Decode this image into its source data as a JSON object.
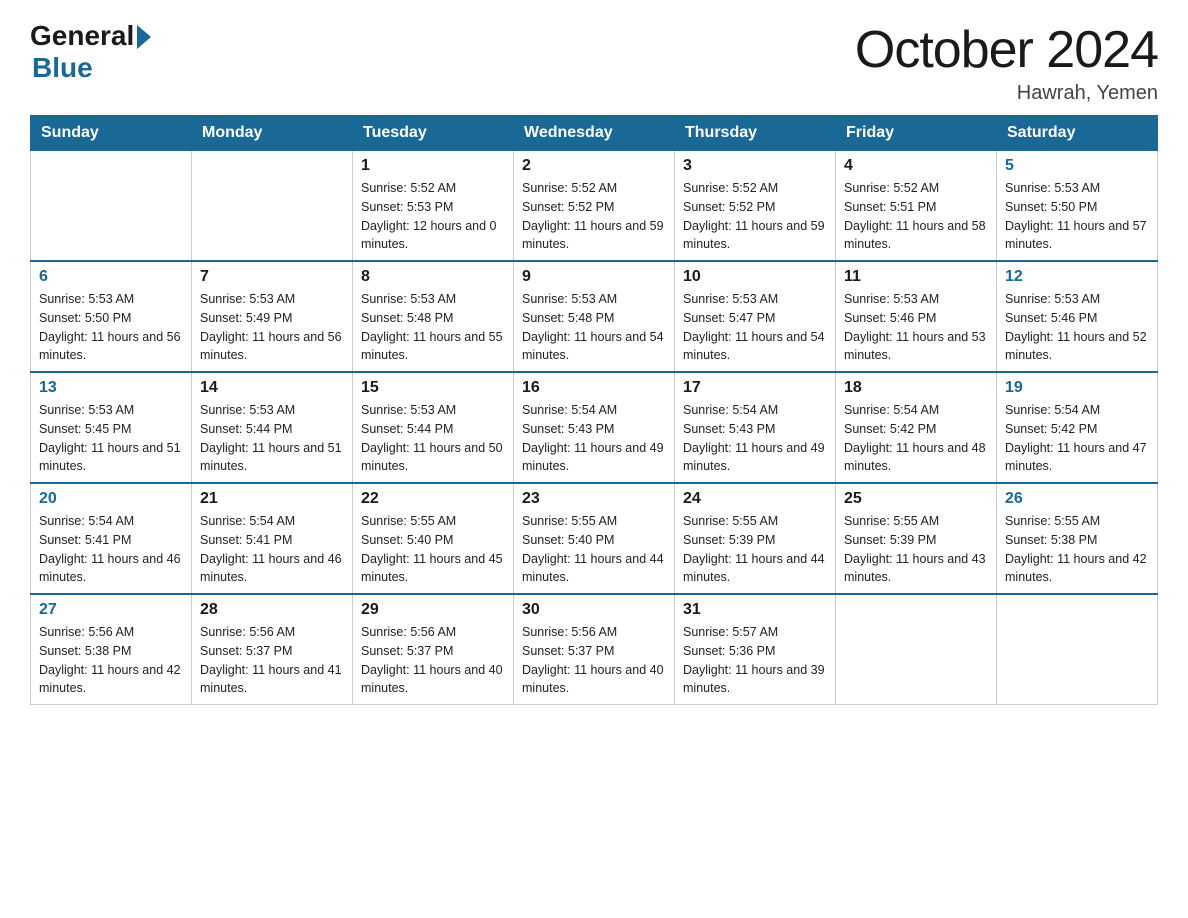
{
  "logo": {
    "general": "General",
    "blue": "Blue"
  },
  "title": "October 2024",
  "location": "Hawrah, Yemen",
  "headers": [
    "Sunday",
    "Monday",
    "Tuesday",
    "Wednesday",
    "Thursday",
    "Friday",
    "Saturday"
  ],
  "weeks": [
    [
      {
        "day": "",
        "sunrise": "",
        "sunset": "",
        "daylight": ""
      },
      {
        "day": "",
        "sunrise": "",
        "sunset": "",
        "daylight": ""
      },
      {
        "day": "1",
        "sunrise": "Sunrise: 5:52 AM",
        "sunset": "Sunset: 5:53 PM",
        "daylight": "Daylight: 12 hours and 0 minutes."
      },
      {
        "day": "2",
        "sunrise": "Sunrise: 5:52 AM",
        "sunset": "Sunset: 5:52 PM",
        "daylight": "Daylight: 11 hours and 59 minutes."
      },
      {
        "day": "3",
        "sunrise": "Sunrise: 5:52 AM",
        "sunset": "Sunset: 5:52 PM",
        "daylight": "Daylight: 11 hours and 59 minutes."
      },
      {
        "day": "4",
        "sunrise": "Sunrise: 5:52 AM",
        "sunset": "Sunset: 5:51 PM",
        "daylight": "Daylight: 11 hours and 58 minutes."
      },
      {
        "day": "5",
        "sunrise": "Sunrise: 5:53 AM",
        "sunset": "Sunset: 5:50 PM",
        "daylight": "Daylight: 11 hours and 57 minutes."
      }
    ],
    [
      {
        "day": "6",
        "sunrise": "Sunrise: 5:53 AM",
        "sunset": "Sunset: 5:50 PM",
        "daylight": "Daylight: 11 hours and 56 minutes."
      },
      {
        "day": "7",
        "sunrise": "Sunrise: 5:53 AM",
        "sunset": "Sunset: 5:49 PM",
        "daylight": "Daylight: 11 hours and 56 minutes."
      },
      {
        "day": "8",
        "sunrise": "Sunrise: 5:53 AM",
        "sunset": "Sunset: 5:48 PM",
        "daylight": "Daylight: 11 hours and 55 minutes."
      },
      {
        "day": "9",
        "sunrise": "Sunrise: 5:53 AM",
        "sunset": "Sunset: 5:48 PM",
        "daylight": "Daylight: 11 hours and 54 minutes."
      },
      {
        "day": "10",
        "sunrise": "Sunrise: 5:53 AM",
        "sunset": "Sunset: 5:47 PM",
        "daylight": "Daylight: 11 hours and 54 minutes."
      },
      {
        "day": "11",
        "sunrise": "Sunrise: 5:53 AM",
        "sunset": "Sunset: 5:46 PM",
        "daylight": "Daylight: 11 hours and 53 minutes."
      },
      {
        "day": "12",
        "sunrise": "Sunrise: 5:53 AM",
        "sunset": "Sunset: 5:46 PM",
        "daylight": "Daylight: 11 hours and 52 minutes."
      }
    ],
    [
      {
        "day": "13",
        "sunrise": "Sunrise: 5:53 AM",
        "sunset": "Sunset: 5:45 PM",
        "daylight": "Daylight: 11 hours and 51 minutes."
      },
      {
        "day": "14",
        "sunrise": "Sunrise: 5:53 AM",
        "sunset": "Sunset: 5:44 PM",
        "daylight": "Daylight: 11 hours and 51 minutes."
      },
      {
        "day": "15",
        "sunrise": "Sunrise: 5:53 AM",
        "sunset": "Sunset: 5:44 PM",
        "daylight": "Daylight: 11 hours and 50 minutes."
      },
      {
        "day": "16",
        "sunrise": "Sunrise: 5:54 AM",
        "sunset": "Sunset: 5:43 PM",
        "daylight": "Daylight: 11 hours and 49 minutes."
      },
      {
        "day": "17",
        "sunrise": "Sunrise: 5:54 AM",
        "sunset": "Sunset: 5:43 PM",
        "daylight": "Daylight: 11 hours and 49 minutes."
      },
      {
        "day": "18",
        "sunrise": "Sunrise: 5:54 AM",
        "sunset": "Sunset: 5:42 PM",
        "daylight": "Daylight: 11 hours and 48 minutes."
      },
      {
        "day": "19",
        "sunrise": "Sunrise: 5:54 AM",
        "sunset": "Sunset: 5:42 PM",
        "daylight": "Daylight: 11 hours and 47 minutes."
      }
    ],
    [
      {
        "day": "20",
        "sunrise": "Sunrise: 5:54 AM",
        "sunset": "Sunset: 5:41 PM",
        "daylight": "Daylight: 11 hours and 46 minutes."
      },
      {
        "day": "21",
        "sunrise": "Sunrise: 5:54 AM",
        "sunset": "Sunset: 5:41 PM",
        "daylight": "Daylight: 11 hours and 46 minutes."
      },
      {
        "day": "22",
        "sunrise": "Sunrise: 5:55 AM",
        "sunset": "Sunset: 5:40 PM",
        "daylight": "Daylight: 11 hours and 45 minutes."
      },
      {
        "day": "23",
        "sunrise": "Sunrise: 5:55 AM",
        "sunset": "Sunset: 5:40 PM",
        "daylight": "Daylight: 11 hours and 44 minutes."
      },
      {
        "day": "24",
        "sunrise": "Sunrise: 5:55 AM",
        "sunset": "Sunset: 5:39 PM",
        "daylight": "Daylight: 11 hours and 44 minutes."
      },
      {
        "day": "25",
        "sunrise": "Sunrise: 5:55 AM",
        "sunset": "Sunset: 5:39 PM",
        "daylight": "Daylight: 11 hours and 43 minutes."
      },
      {
        "day": "26",
        "sunrise": "Sunrise: 5:55 AM",
        "sunset": "Sunset: 5:38 PM",
        "daylight": "Daylight: 11 hours and 42 minutes."
      }
    ],
    [
      {
        "day": "27",
        "sunrise": "Sunrise: 5:56 AM",
        "sunset": "Sunset: 5:38 PM",
        "daylight": "Daylight: 11 hours and 42 minutes."
      },
      {
        "day": "28",
        "sunrise": "Sunrise: 5:56 AM",
        "sunset": "Sunset: 5:37 PM",
        "daylight": "Daylight: 11 hours and 41 minutes."
      },
      {
        "day": "29",
        "sunrise": "Sunrise: 5:56 AM",
        "sunset": "Sunset: 5:37 PM",
        "daylight": "Daylight: 11 hours and 40 minutes."
      },
      {
        "day": "30",
        "sunrise": "Sunrise: 5:56 AM",
        "sunset": "Sunset: 5:37 PM",
        "daylight": "Daylight: 11 hours and 40 minutes."
      },
      {
        "day": "31",
        "sunrise": "Sunrise: 5:57 AM",
        "sunset": "Sunset: 5:36 PM",
        "daylight": "Daylight: 11 hours and 39 minutes."
      },
      {
        "day": "",
        "sunrise": "",
        "sunset": "",
        "daylight": ""
      },
      {
        "day": "",
        "sunrise": "",
        "sunset": "",
        "daylight": ""
      }
    ]
  ]
}
